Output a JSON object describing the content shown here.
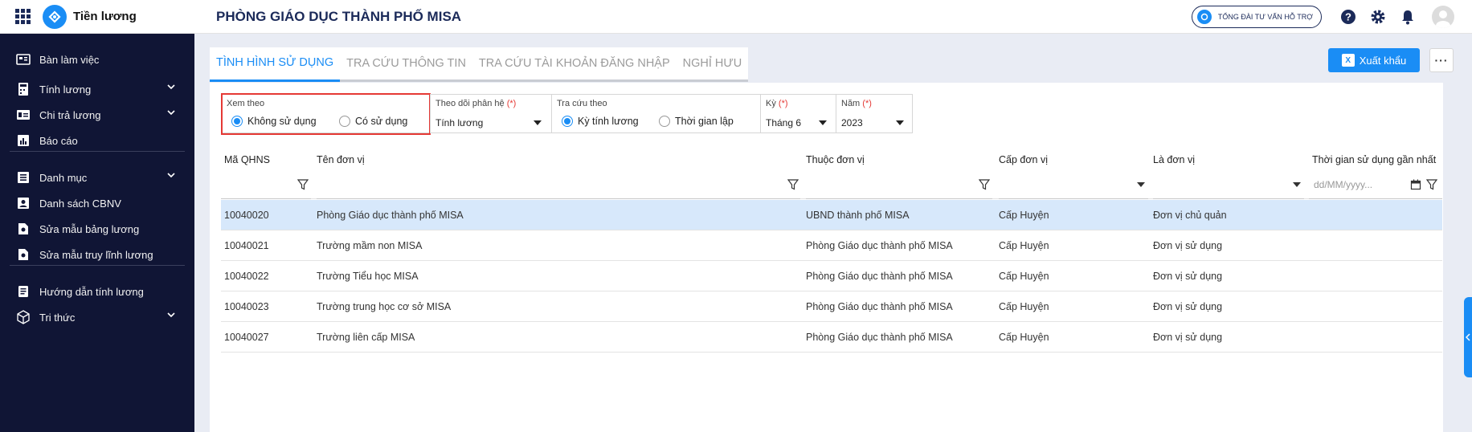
{
  "app": {
    "name": "Tiền lương",
    "org_title": "PHÒNG GIÁO DỤC THÀNH PHỐ MISA"
  },
  "topbar": {
    "support_label": "TỔNG ĐÀI TƯ VẤN HỖ TRỢ"
  },
  "sidebar": {
    "items": [
      {
        "label": "Bàn làm việc",
        "icon": "dashboard-icon",
        "has_children": false
      },
      {
        "label": "Tính lương",
        "icon": "calculator-icon",
        "has_children": true
      },
      {
        "label": "Chi trả lương",
        "icon": "payment-icon",
        "has_children": true
      },
      {
        "label": "Báo cáo",
        "icon": "report-icon",
        "has_children": false
      },
      {
        "label": "Danh mục",
        "icon": "catalog-icon",
        "has_children": true
      },
      {
        "label": "Danh sách CBNV",
        "icon": "staff-list-icon",
        "has_children": false
      },
      {
        "label": "Sửa mẫu bảng lương",
        "icon": "template-edit-icon",
        "has_children": false
      },
      {
        "label": "Sửa mẫu truy lĩnh lương",
        "icon": "template-edit-icon",
        "has_children": false
      },
      {
        "label": "Hướng dẫn tính lương",
        "icon": "guide-icon",
        "has_children": false
      },
      {
        "label": "Tri thức",
        "icon": "knowledge-cube-icon",
        "has_children": true
      }
    ]
  },
  "tabs": [
    {
      "label": "TÌNH HÌNH SỬ DỤNG",
      "active": true
    },
    {
      "label": "TRA CỨU THÔNG TIN",
      "active": false
    },
    {
      "label": "TRA CỨU TÀI KHOẢN ĐĂNG NHẬP",
      "active": false
    },
    {
      "label": "NGHỈ HƯU",
      "active": false
    }
  ],
  "toolbar": {
    "export_label": "Xuất khẩu",
    "more_label": "···"
  },
  "filters": {
    "view_by": {
      "label": "Xem theo",
      "options": [
        "Không sử dụng",
        "Có sử dụng"
      ],
      "selected": "Không sử dụng"
    },
    "module": {
      "label": "Theo dõi phân hệ",
      "required_mark": "(*)",
      "value": "Tính lương"
    },
    "lookup_by": {
      "label": "Tra cứu theo",
      "options": [
        "Kỳ tính lương",
        "Thời gian lập"
      ],
      "selected": "Kỳ tính lương"
    },
    "period": {
      "label": "Kỳ",
      "required_mark": "(*)",
      "value": "Tháng 6"
    },
    "year": {
      "label": "Năm",
      "required_mark": "(*)",
      "value": "2023"
    }
  },
  "table": {
    "columns": [
      "Mã QHNS",
      "Tên đơn vị",
      "Thuộc đơn vị",
      "Cấp đơn vị",
      "Là đơn vị",
      "Thời gian sử dụng gần nhất"
    ],
    "date_placeholder": "dd/MM/yyyy...",
    "rows": [
      {
        "code": "10040020",
        "name": "Phòng Giáo dục thành phố MISA",
        "parent": "UBND thành phố MISA",
        "level": "Cấp Huyện",
        "type": "Đơn vị chủ quản",
        "last_used": ""
      },
      {
        "code": "10040021",
        "name": "Trường mầm non MISA",
        "parent": "Phòng Giáo dục thành phố MISA",
        "level": "Cấp Huyện",
        "type": "Đơn vị sử dụng",
        "last_used": ""
      },
      {
        "code": "10040022",
        "name": "Trường Tiểu học MISA",
        "parent": "Phòng Giáo dục thành phố MISA",
        "level": "Cấp Huyện",
        "type": "Đơn vị sử dụng",
        "last_used": ""
      },
      {
        "code": "10040023",
        "name": "Trường trung học cơ sở MISA",
        "parent": "Phòng Giáo dục thành phố MISA",
        "level": "Cấp Huyện",
        "type": "Đơn vị sử dụng",
        "last_used": ""
      },
      {
        "code": "10040027",
        "name": "Trường liên cấp MISA",
        "parent": "Phòng Giáo dục thành phố MISA",
        "level": "Cấp Huyện",
        "type": "Đơn vị sử dụng",
        "last_used": ""
      }
    ],
    "selected_row": 0
  },
  "colors": {
    "accent": "#1a8df5",
    "sidebar_bg": "#101535",
    "highlight_border": "#e53935",
    "selected_row": "#d7e8fb"
  }
}
